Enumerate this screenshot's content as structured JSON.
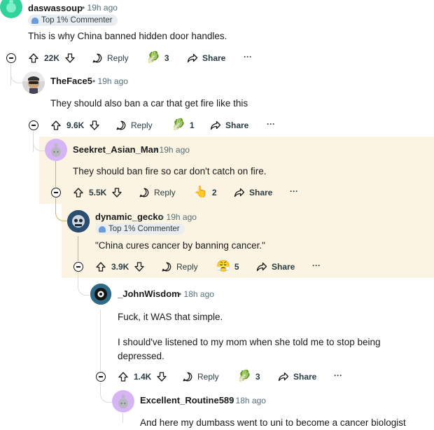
{
  "comments": [
    {
      "username": "daswassoup",
      "time": "19h ago",
      "badge": "Top 1% Commenter",
      "lines": [
        "This is why China banned hidden door handles."
      ],
      "votes": "22K",
      "reply": "Reply",
      "award_count": "3",
      "share": "Share",
      "more": "···",
      "avatar_color": "#2fd39b",
      "award_icon": "🥬"
    },
    {
      "username": "TheFace5",
      "time": "19h ago",
      "badge": "",
      "lines": [
        "They should also ban a car that get fire like this"
      ],
      "votes": "9.6K",
      "reply": "Reply",
      "award_count": "1",
      "share": "Share",
      "more": "···",
      "avatar_color": "#d7d7d7",
      "award_icon": "🥬"
    },
    {
      "username": "Seekret_Asian_Man",
      "time": "19h ago",
      "badge": "",
      "lines": [
        "They should ban fire so car don't catch on fire."
      ],
      "votes": "5.5K",
      "reply": "Reply",
      "award_count": "2",
      "share": "Share",
      "more": "···",
      "avatar_color": "#d7b5f5",
      "award_icon": "👆"
    },
    {
      "username": "dynamic_gecko",
      "time": "19h ago",
      "badge": "Top 1% Commenter",
      "lines": [
        "\"China cures cancer by banning cancer.\""
      ],
      "votes": "3.9K",
      "reply": "Reply",
      "award_count": "5",
      "share": "Share",
      "more": "···",
      "avatar_color": "#3c6b93",
      "award_icon": "😤"
    },
    {
      "username": "_JohnWisdom",
      "time": "18h ago",
      "badge": "",
      "lines": [
        "Fuck, it WAS that simple.",
        "I should've listened to my mom when she told me to stop being",
        "depressed."
      ],
      "votes": "1.4K",
      "reply": "Reply",
      "award_count": "3",
      "share": "Share",
      "more": "···",
      "avatar_color": "#3b7fa0",
      "award_icon": "🥬"
    },
    {
      "username": "Excellent_Routine589",
      "time": "18h ago",
      "badge": "",
      "lines": [
        "And here my dumbass went to uni to become a cancer biologist"
      ],
      "votes": "",
      "reply": "",
      "award_count": "",
      "share": "",
      "more": "",
      "avatar_color": "#d7b5f5",
      "award_icon": ""
    }
  ],
  "separator": "•",
  "colors": {
    "highlight": "#fbf4e2",
    "thread_gold": "#d9b35a",
    "thread_gray": "#dcdcdc",
    "meta": "#576f76"
  }
}
